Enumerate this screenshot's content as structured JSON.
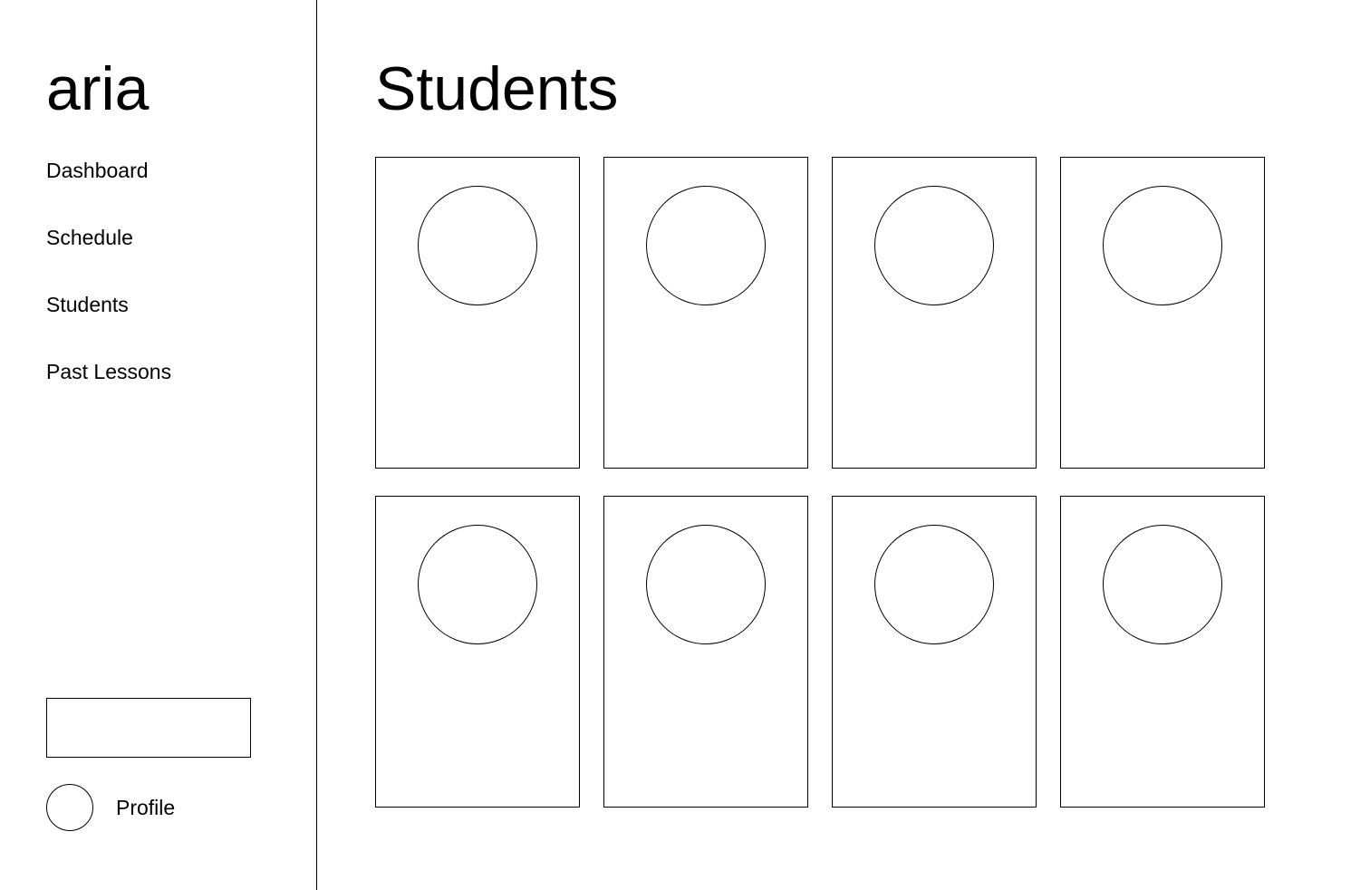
{
  "sidebar": {
    "brand": "aria",
    "nav": [
      {
        "label": "Dashboard"
      },
      {
        "label": "Schedule"
      },
      {
        "label": "Students"
      },
      {
        "label": "Past Lessons"
      }
    ],
    "profile": {
      "label": "Profile",
      "icon": "avatar-placeholder"
    }
  },
  "main": {
    "title": "Students",
    "cards": [
      {
        "avatar": "avatar-placeholder"
      },
      {
        "avatar": "avatar-placeholder"
      },
      {
        "avatar": "avatar-placeholder"
      },
      {
        "avatar": "avatar-placeholder"
      },
      {
        "avatar": "avatar-placeholder"
      },
      {
        "avatar": "avatar-placeholder"
      },
      {
        "avatar": "avatar-placeholder"
      },
      {
        "avatar": "avatar-placeholder"
      }
    ]
  },
  "colors": {
    "background": "#ffffff",
    "line": "#000000",
    "text": "#000000"
  }
}
